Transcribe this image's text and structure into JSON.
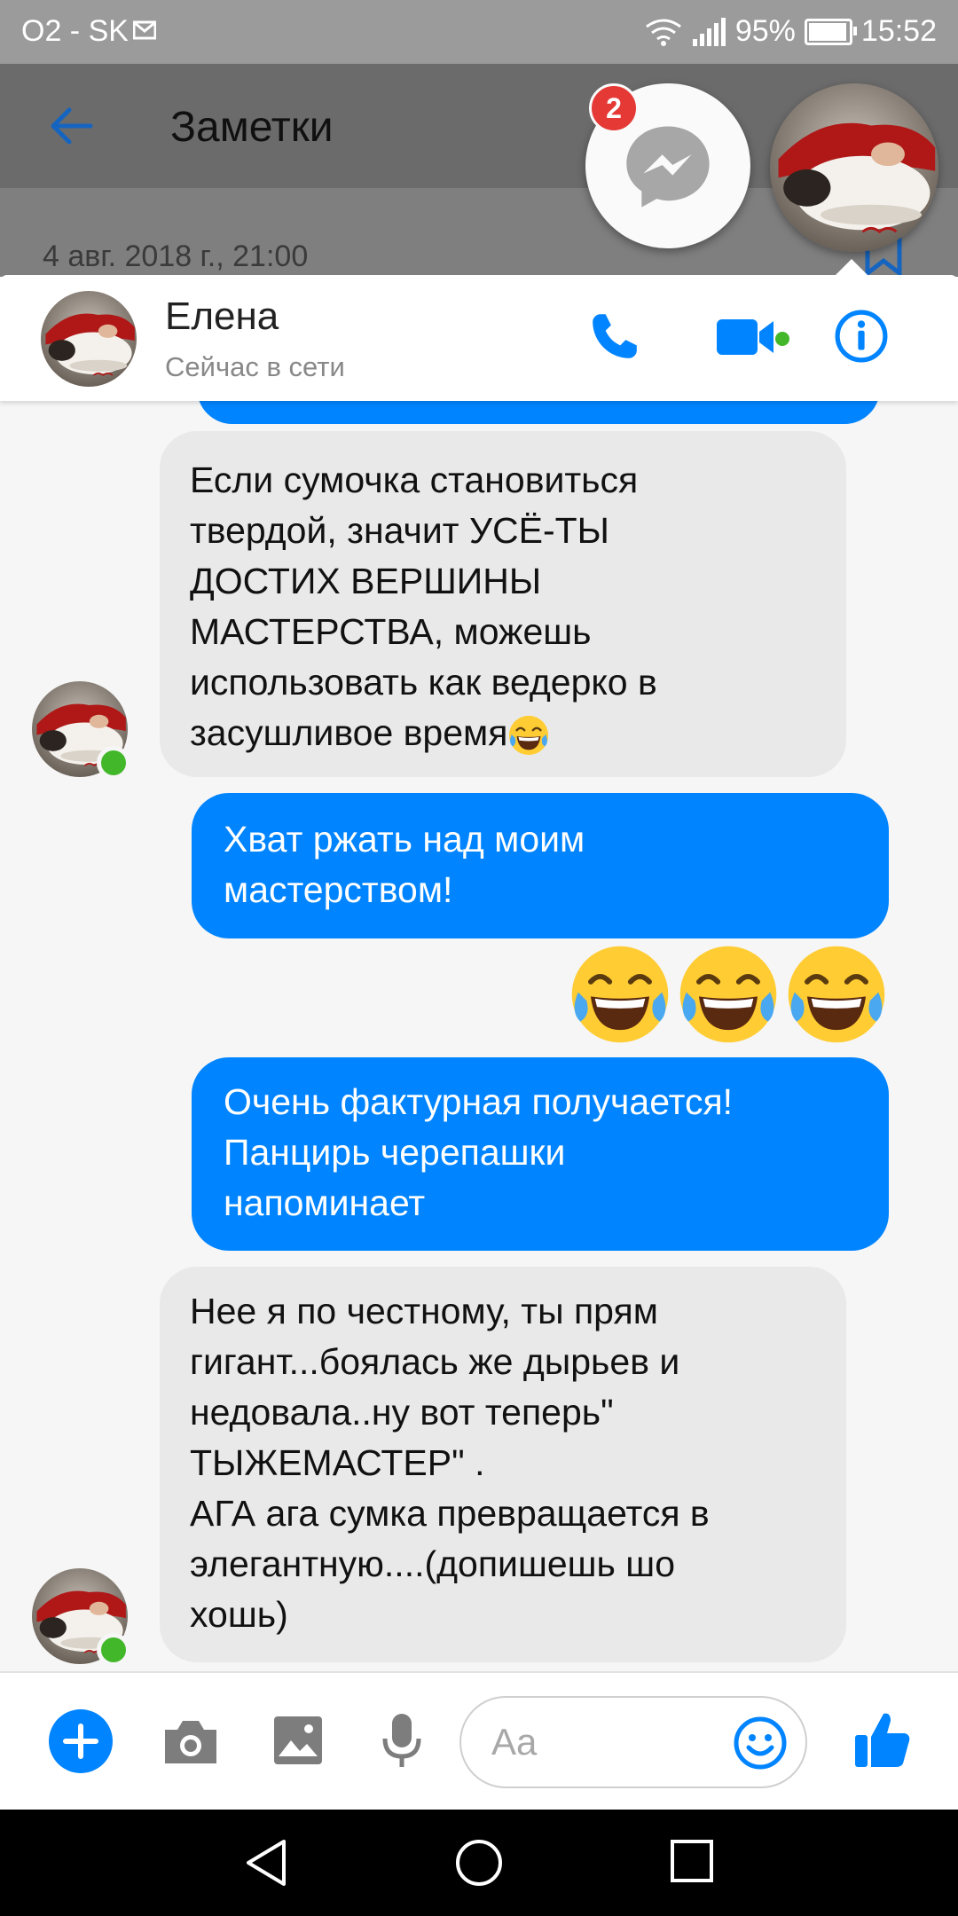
{
  "statusbar": {
    "carrier": "O2 - SK",
    "battery": "95%",
    "battery_level": 0.95,
    "time": "15:52"
  },
  "notes": {
    "title": "Заметки",
    "date": "4 авг. 2018 г., 21:00"
  },
  "chathead": {
    "badge_count": "2"
  },
  "chat": {
    "contact_name": "Елена",
    "contact_status": "Сейчас в сети"
  },
  "messages": [
    {
      "dir": "in",
      "lines": [
        "Если сумочка становиться",
        "твердой, значит УСЁ-ТЫ",
        "ДОСТИХ  ВЕРШИНЫ",
        "МАСТЕРСТВА,  можешь",
        "использовать как ведерко в",
        "засушливое  время"
      ],
      "trailing_emoji": "laughing-tears"
    },
    {
      "dir": "out",
      "lines": [
        "Хват ржать над моим",
        "мастерством!"
      ]
    },
    {
      "dir": "out",
      "emoji_only": [
        "laughing-tears",
        "laughing-tears",
        "laughing-tears"
      ]
    },
    {
      "dir": "out",
      "lines": [
        "Очень фактурная получается!",
        "Панцирь черепашки",
        "напоминает"
      ]
    },
    {
      "dir": "in",
      "lines": [
        "Нее я по честному, ты прям",
        "гигант...боялась же дырьев и",
        "недовала..ну вот теперь\"",
        "ТЫЖЕМАСТЕР\" .",
        "АГА ага сумка превращается в",
        "элегантную....(допишешь шо",
        "хошь)"
      ]
    }
  ],
  "composer": {
    "placeholder": "Aa"
  },
  "icons": {
    "back": "arrow-left-icon",
    "bookmark": "bookmark-icon",
    "messenger": "messenger-icon",
    "phone": "phone-icon",
    "video": "video-camera-icon",
    "info": "info-icon",
    "plus": "plus-icon",
    "camera": "camera-icon",
    "gallery": "image-icon",
    "mic": "microphone-icon",
    "emoji": "smiley-icon",
    "like": "thumbs-up-icon",
    "nav_back": "triangle-back-icon",
    "nav_home": "circle-home-icon",
    "nav_recent": "square-recents-icon"
  },
  "colors": {
    "accent": "#0084ff",
    "incoming_bubble": "#e9e9e9",
    "online": "#42b72a",
    "badge": "#e53935"
  }
}
